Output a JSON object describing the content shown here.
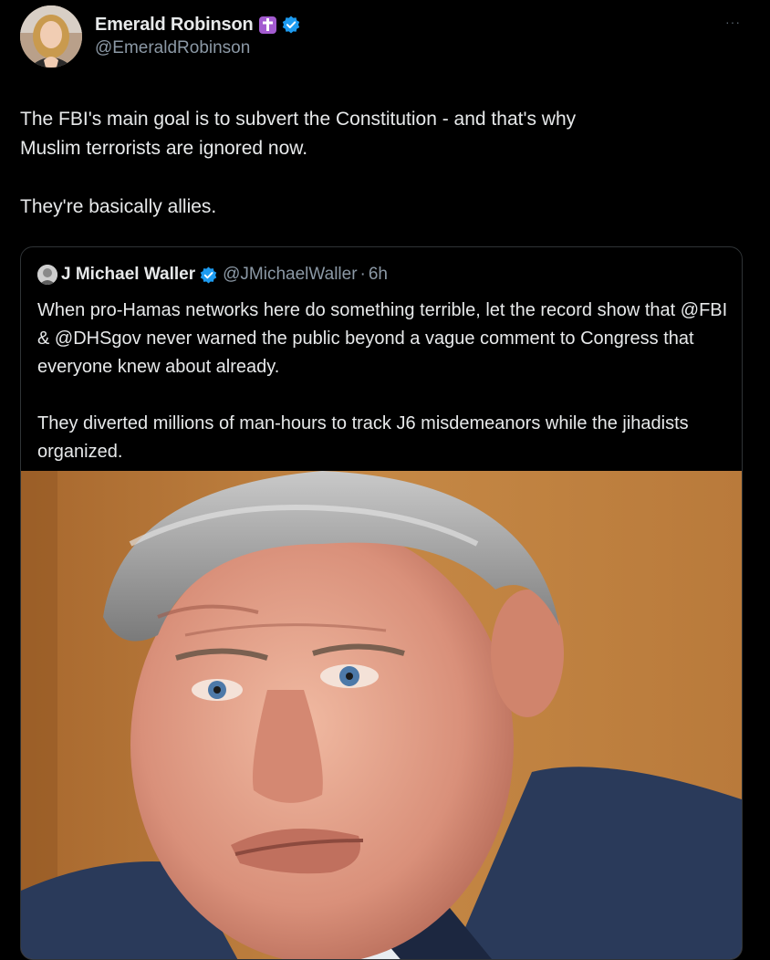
{
  "tweet": {
    "display_name": "Emerald Robinson",
    "handle": "@EmeraldRobinson",
    "text_paragraphs": [
      "The FBI's main goal is to subvert the Constitution - and that's why Muslim terrorists are ignored now.",
      "They're basically allies."
    ],
    "more_icon": "···",
    "badges": [
      "cross-badge",
      "verified-badge"
    ],
    "colors": {
      "verified": "#1d9bf0",
      "cross_badge": "#a35bd0",
      "secondary_text": "#8b98a5"
    }
  },
  "quote": {
    "display_name": "J Michael Waller",
    "handle": "@JMichaelWaller",
    "separator": "·",
    "time": "6h",
    "text_paragraphs": [
      "When pro-Hamas networks here do something terrible, let the record show that @FBI & @DHSgov never warned the public beyond a vague comment to Congress that everyone knew about already.",
      "They diverted millions of man-hours to track J6 misdemeanors while the jihadists organized."
    ],
    "media_icon": "photo-of-man-in-suit"
  }
}
